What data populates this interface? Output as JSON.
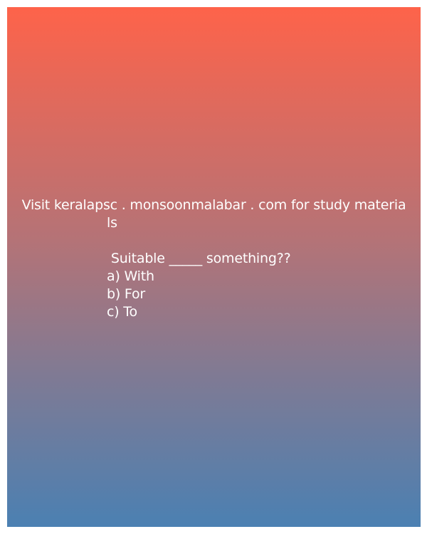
{
  "watermark": {
    "line1": "Visit keralapsc . monsoonmalabar . com for study materia",
    "line2": "ls"
  },
  "question": {
    "text": " Suitable _____ something??",
    "options": [
      "a) With",
      "b) For",
      "c) To"
    ]
  },
  "colors": {
    "gradient_top": "#fe634a",
    "gradient_bottom": "#4b80b2",
    "text": "#ffffff"
  }
}
